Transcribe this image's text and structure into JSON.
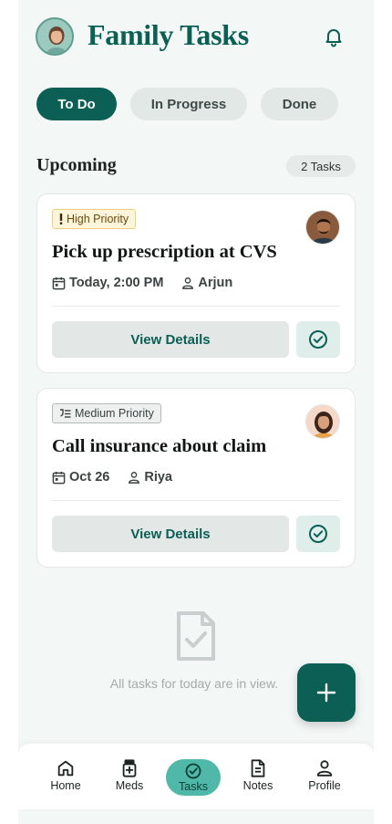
{
  "header": {
    "title": "Family Tasks",
    "avatar_icon": "user-avatar",
    "bell_icon": "bell-icon"
  },
  "tabs": [
    {
      "label": "To Do",
      "active": true
    },
    {
      "label": "In Progress",
      "active": false
    },
    {
      "label": "Done",
      "active": false
    }
  ],
  "section": {
    "title": "Upcoming",
    "count_label": "2 Tasks"
  },
  "tasks": [
    {
      "priority_label": "High Priority",
      "priority_icon": "exclamation-icon",
      "title": "Pick up prescription at CVS",
      "due": "Today, 2:00 PM",
      "assignee": "Arjun",
      "view_label": "View Details"
    },
    {
      "priority_label": "Medium Priority",
      "priority_icon": "medium-priority-icon",
      "title": "Call insurance about claim",
      "due": "Oct 26",
      "assignee": "Riya",
      "view_label": "View Details"
    }
  ],
  "empty_state": {
    "text": "All tasks for today are in view."
  },
  "nav": [
    {
      "label": "Home",
      "icon": "home-icon"
    },
    {
      "label": "Meds",
      "icon": "meds-icon"
    },
    {
      "label": "Tasks",
      "icon": "tasks-icon",
      "active": true
    },
    {
      "label": "Notes",
      "icon": "notes-icon"
    },
    {
      "label": "Profile",
      "icon": "profile-icon"
    }
  ],
  "colors": {
    "brand": "#0b5f54",
    "accent": "#4fb8a8",
    "background": "#f3f7f6",
    "high_priority_bg": "#fdf4dc",
    "medium_priority_bg": "#eef0f0"
  }
}
